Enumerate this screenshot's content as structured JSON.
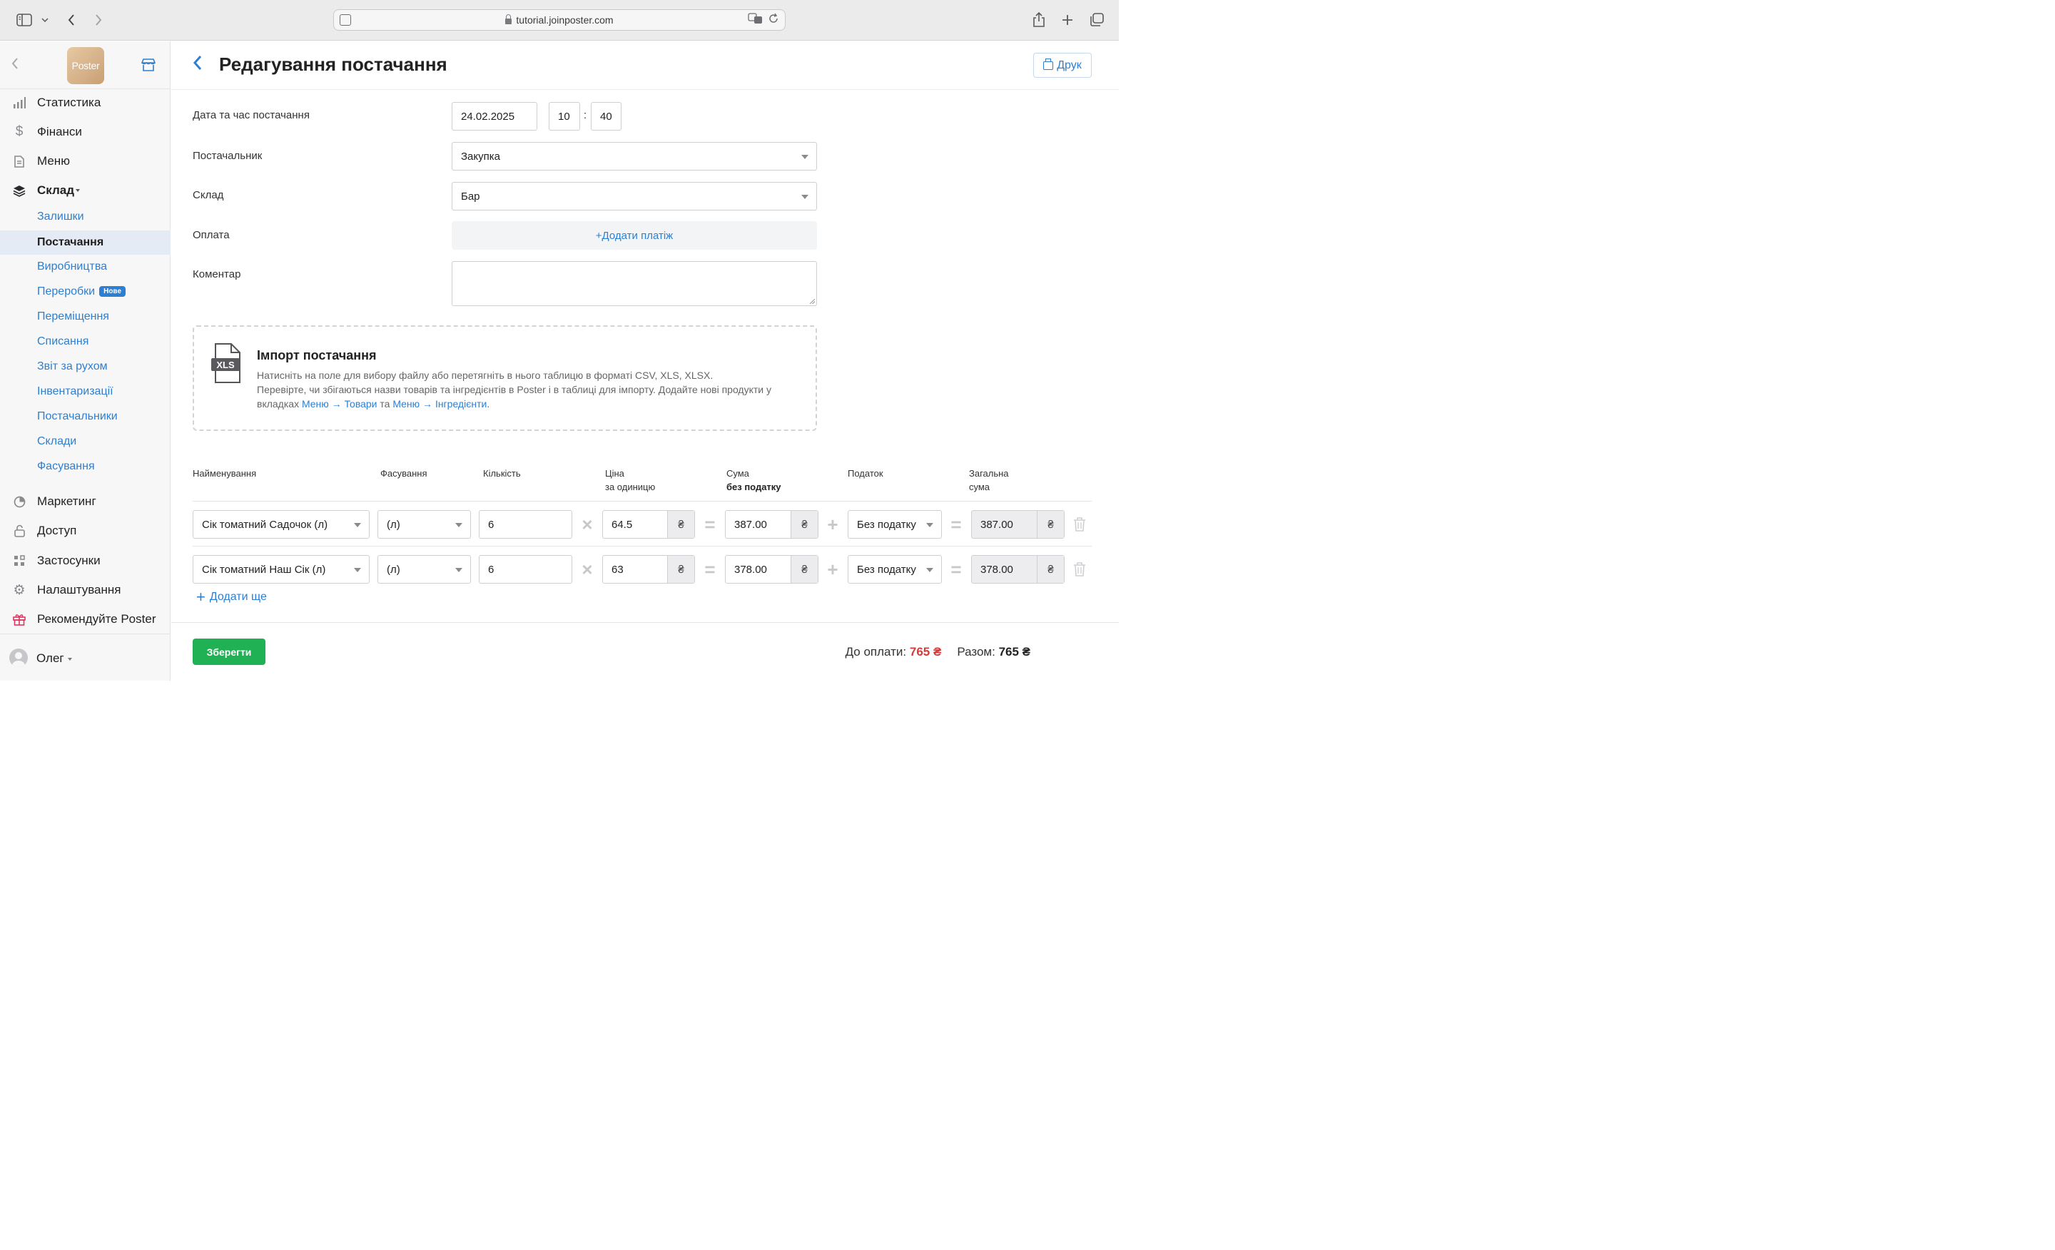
{
  "browser": {
    "url": "tutorial.joinposter.com"
  },
  "sidebar": {
    "logo_text": "Poster",
    "nav": [
      {
        "label": "Статистика",
        "icon": "bar-chart-icon"
      },
      {
        "label": "Фінанси",
        "icon": "dollar-icon"
      },
      {
        "label": "Меню",
        "icon": "document-icon"
      },
      {
        "label": "Склад",
        "icon": "layers-icon"
      }
    ],
    "warehouse_sub": [
      {
        "label": "Залишки"
      },
      {
        "label": "Постачання",
        "active": true
      },
      {
        "label": "Виробництва"
      },
      {
        "label": "Переробки",
        "badge": "Нове"
      },
      {
        "label": "Переміщення"
      },
      {
        "label": "Списання"
      },
      {
        "label": "Звіт за рухом"
      },
      {
        "label": "Інвентаризації"
      },
      {
        "label": "Постачальники"
      },
      {
        "label": "Склади"
      },
      {
        "label": "Фасування"
      }
    ],
    "nav_bottom": [
      {
        "label": "Маркетинг",
        "icon": "pie-chart-icon"
      },
      {
        "label": "Доступ",
        "icon": "lock-icon"
      },
      {
        "label": "Застосунки",
        "icon": "apps-grid-icon"
      },
      {
        "label": "Налаштування",
        "icon": "gear-icon"
      },
      {
        "label": "Рекомендуйте Poster",
        "icon": "gift-icon"
      }
    ],
    "user": "Олег"
  },
  "header": {
    "title": "Редагування постачання",
    "print_label": "Друк"
  },
  "form": {
    "datetime_label": "Дата та час постачання",
    "date": "24.02.2025",
    "hour": "10",
    "minute": "40",
    "supplier_label": "Постачальник",
    "supplier_value": "Закупка",
    "warehouse_label": "Склад",
    "warehouse_value": "Бар",
    "payment_label": "Оплата",
    "add_payment": "+Додати платіж",
    "comment_label": "Коментар",
    "comment_value": ""
  },
  "import": {
    "title": "Імпорт постачання",
    "icon_text": "XLS",
    "line1": "Натисніть на поле для вибору файлу або перетягніть в нього таблицю в форматі CSV, XLS, XLSX.",
    "line2": "Перевірте, чи збігаються назви товарів та інгредієнтів в Poster і в таблиці для імпорту. Додайте нові продукти у вкладках",
    "link1": "Меню → Товари",
    "and": "та",
    "link2": "Меню → Інгредієнти",
    "end": "."
  },
  "table": {
    "headers": {
      "name": "Найменування",
      "packing": "Фасування",
      "qty": "Кількість",
      "price_1": "Ціна",
      "price_2": "за одиницю",
      "sum_1": "Сума",
      "sum_2": "без податку",
      "tax": "Податок",
      "total_1": "Загальна",
      "total_2": "сума"
    },
    "currency": "₴",
    "rows": [
      {
        "name": "Сік томатний Садочок (л)",
        "packing": "(л)",
        "qty": "6",
        "price": "64.5",
        "sum": "387.00",
        "tax": "Без податку",
        "total": "387.00"
      },
      {
        "name": "Сік томатний Наш Сік (л)",
        "packing": "(л)",
        "qty": "6",
        "price": "63",
        "sum": "378.00",
        "tax": "Без податку",
        "total": "378.00"
      }
    ],
    "add_more": "Додати ще"
  },
  "footer": {
    "save": "Зберегти",
    "due_label": "До оплати:",
    "due_value": "765 ₴",
    "total_label": "Разом:",
    "total_value": "765 ₴"
  }
}
